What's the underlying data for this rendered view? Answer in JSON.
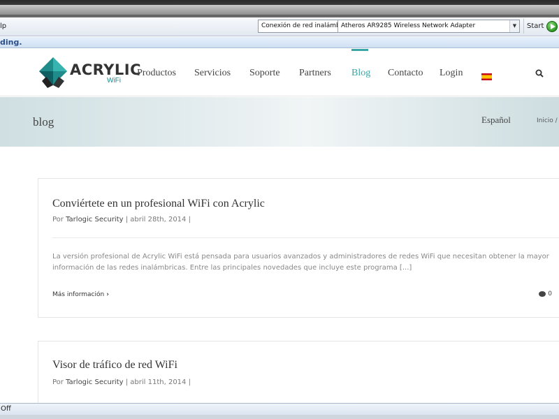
{
  "toolbar": {
    "menu_tail": "lp",
    "adapter_connection": "Conexión de red inalámbrica",
    "adapter_name": "Atheros AR9285 Wireless Network Adapter",
    "start_label": "Start"
  },
  "loading_text": "ding.",
  "site": {
    "logo_text": "ACRYLIC",
    "logo_sub": "WiFi",
    "nav": [
      {
        "label": "Productos"
      },
      {
        "label": "Servicios"
      },
      {
        "label": "Soporte"
      },
      {
        "label": "Partners"
      },
      {
        "label": "Blog",
        "active": true
      },
      {
        "label": "Contacto"
      },
      {
        "label": "Login"
      }
    ],
    "accent_color": "#3aa6a6"
  },
  "hero": {
    "title": "blog",
    "language": "Español",
    "breadcrumb": "Inicio /"
  },
  "posts": [
    {
      "title": "Conviértete en un profesional WiFi con Acrylic",
      "meta_prefix": "Por",
      "author": "Tarlogic Security",
      "date": "| abril 28th, 2014 |",
      "excerpt": "La versión profesional de Acrylic WiFi está pensada para usuarios avanzados y administradores de redes WiFi que necesitan obtener la mayor información de las redes inalámbricas. Entre las principales novedades que incluye este programa [...]",
      "read_more": "Más información",
      "comment_count": "0"
    },
    {
      "title": "Visor de tráfico de red WiFi",
      "meta_prefix": "Por",
      "author": "Tarlogic Security",
      "date": "| abril 11th, 2014 |"
    }
  ],
  "status_bar": "Off"
}
